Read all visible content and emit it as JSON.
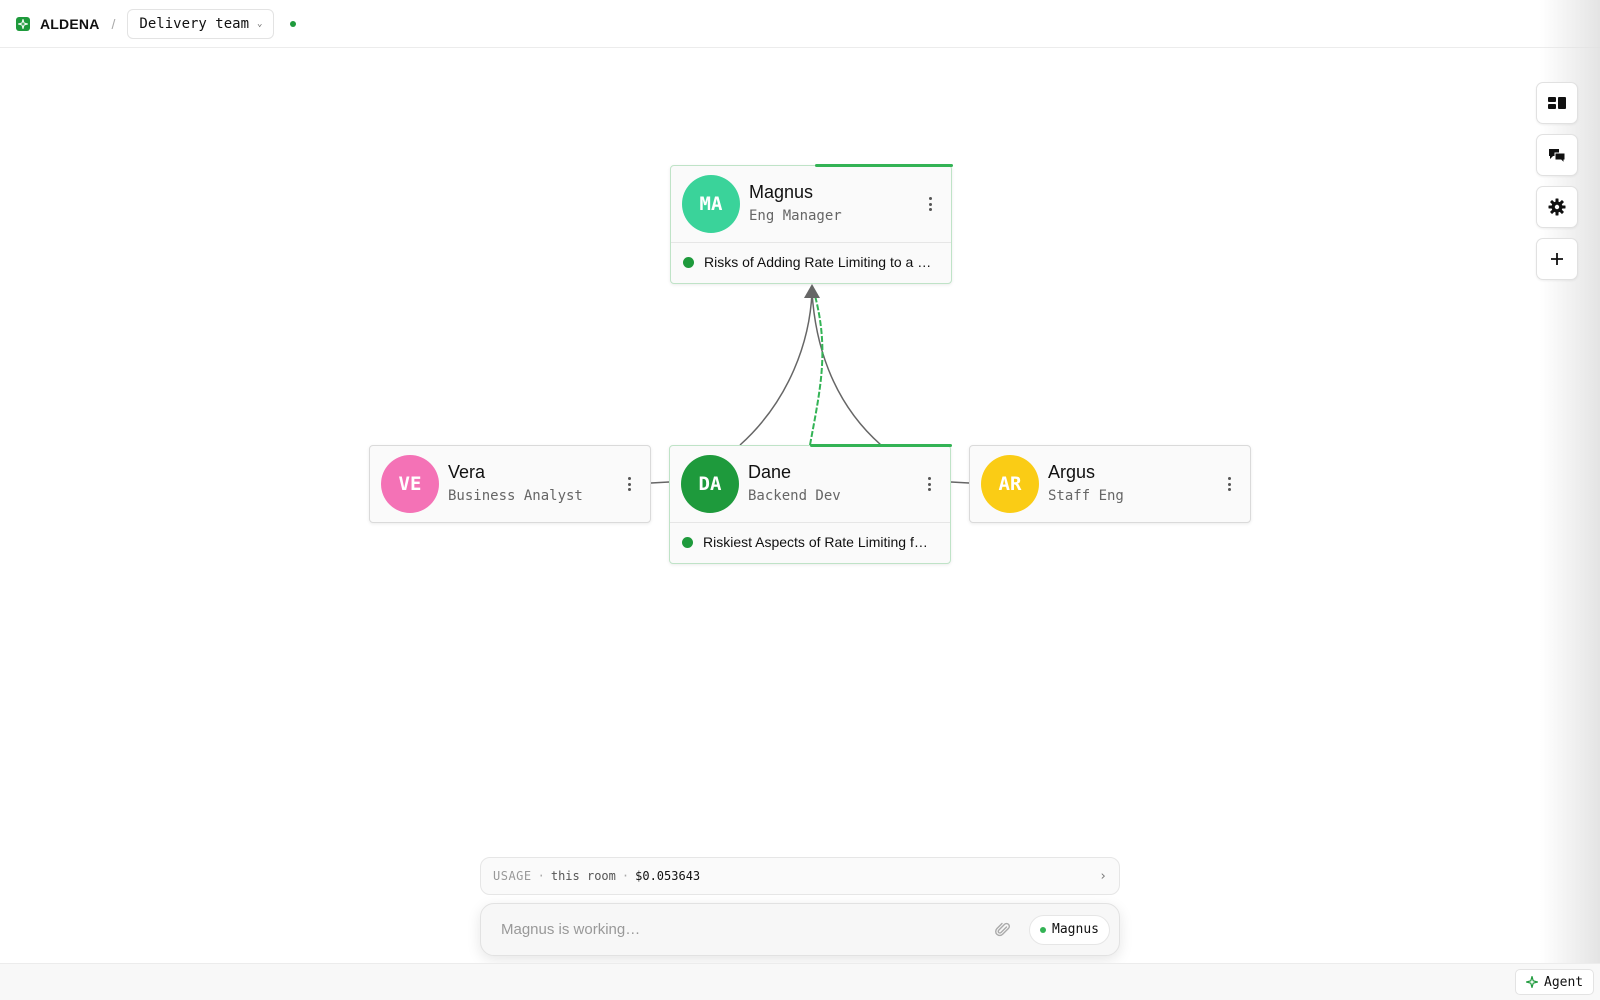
{
  "header": {
    "brand": "ALDENA",
    "separator": "/",
    "team": "Delivery team"
  },
  "agents": {
    "magnus": {
      "initials": "MA",
      "name": "Magnus",
      "role": "Eng Manager",
      "color": "#3ad39a",
      "task": "Risks of Adding Rate Limiting to a …"
    },
    "vera": {
      "initials": "VE",
      "name": "Vera",
      "role": "Business Analyst",
      "color": "#f472b6"
    },
    "dane": {
      "initials": "DA",
      "name": "Dane",
      "role": "Backend Dev",
      "color": "#1e9a3c",
      "task": "Riskiest Aspects of Rate Limiting f…"
    },
    "argus": {
      "initials": "AR",
      "name": "Argus",
      "role": "Staff Eng",
      "color": "#facc15"
    }
  },
  "toolbar": {
    "items": [
      "layout-icon",
      "comments-icon",
      "settings-icon",
      "add-icon"
    ]
  },
  "usage": {
    "label": "USAGE",
    "dot1": "·",
    "scope": "this room",
    "dot2": "·",
    "cost": "$0.053643",
    "arrow": "›"
  },
  "composer": {
    "placeholder": "Magnus is working…",
    "mention": "Magnus"
  },
  "footer": {
    "agent_label": "Agent"
  },
  "colors": {
    "accent": "#1e9a3c",
    "edge": "#666666",
    "active_edge": "#33b355"
  }
}
